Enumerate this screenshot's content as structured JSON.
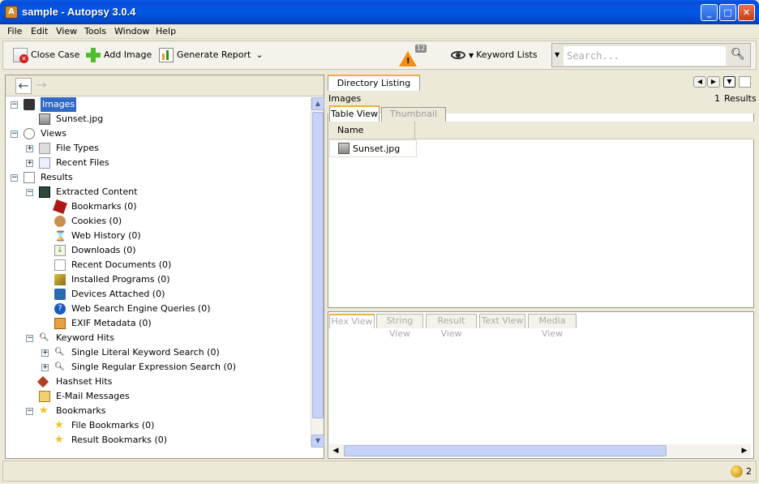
{
  "window": {
    "title": "sample - Autopsy 3.0.4",
    "app_icon": "A"
  },
  "menu": [
    "File",
    "Edit",
    "View",
    "Tools",
    "Window",
    "Help"
  ],
  "toolbar": {
    "close_case": "Close Case",
    "add_image": "Add Image",
    "generate_report": "Generate Report",
    "alert_count": "12",
    "keyword_lists": "Keyword Lists",
    "search_placeholder": "Search..."
  },
  "tree": {
    "images": "Images",
    "sunset": "Sunset.jpg",
    "views": "Views",
    "file_types": "File Types",
    "recent_files": "Recent Files",
    "results": "Results",
    "extracted_content": "Extracted Content",
    "bookmarks_a": "Bookmarks (0)",
    "cookies": "Cookies (0)",
    "web_history": "Web History (0)",
    "downloads": "Downloads (0)",
    "recent_documents": "Recent Documents (0)",
    "installed_programs": "Installed Programs (0)",
    "devices_attached": "Devices Attached (0)",
    "web_search": "Web Search Engine Queries (0)",
    "exif": "EXIF Metadata (0)",
    "keyword_hits": "Keyword Hits",
    "single_literal": "Single Literal Keyword Search (0)",
    "single_regex": "Single Regular Expression Search (0)",
    "hashset_hits": "Hashset Hits",
    "email": "E-Mail Messages",
    "bookmarks_b": "Bookmarks",
    "file_bookmarks": "File Bookmarks (0)",
    "result_bookmarks": "Result Bookmarks (0)"
  },
  "directory": {
    "tab": "Directory Listing",
    "path": "Images",
    "result_count": "1",
    "results_label": "Results",
    "table_view": "Table View",
    "thumbnail_view": "Thumbnail View",
    "col_name": "Name",
    "row_name": "Sunset.jpg"
  },
  "content_tabs": [
    "Hex View",
    "String View",
    "Result View",
    "Text View",
    "Media View"
  ],
  "status": {
    "count": "2"
  }
}
